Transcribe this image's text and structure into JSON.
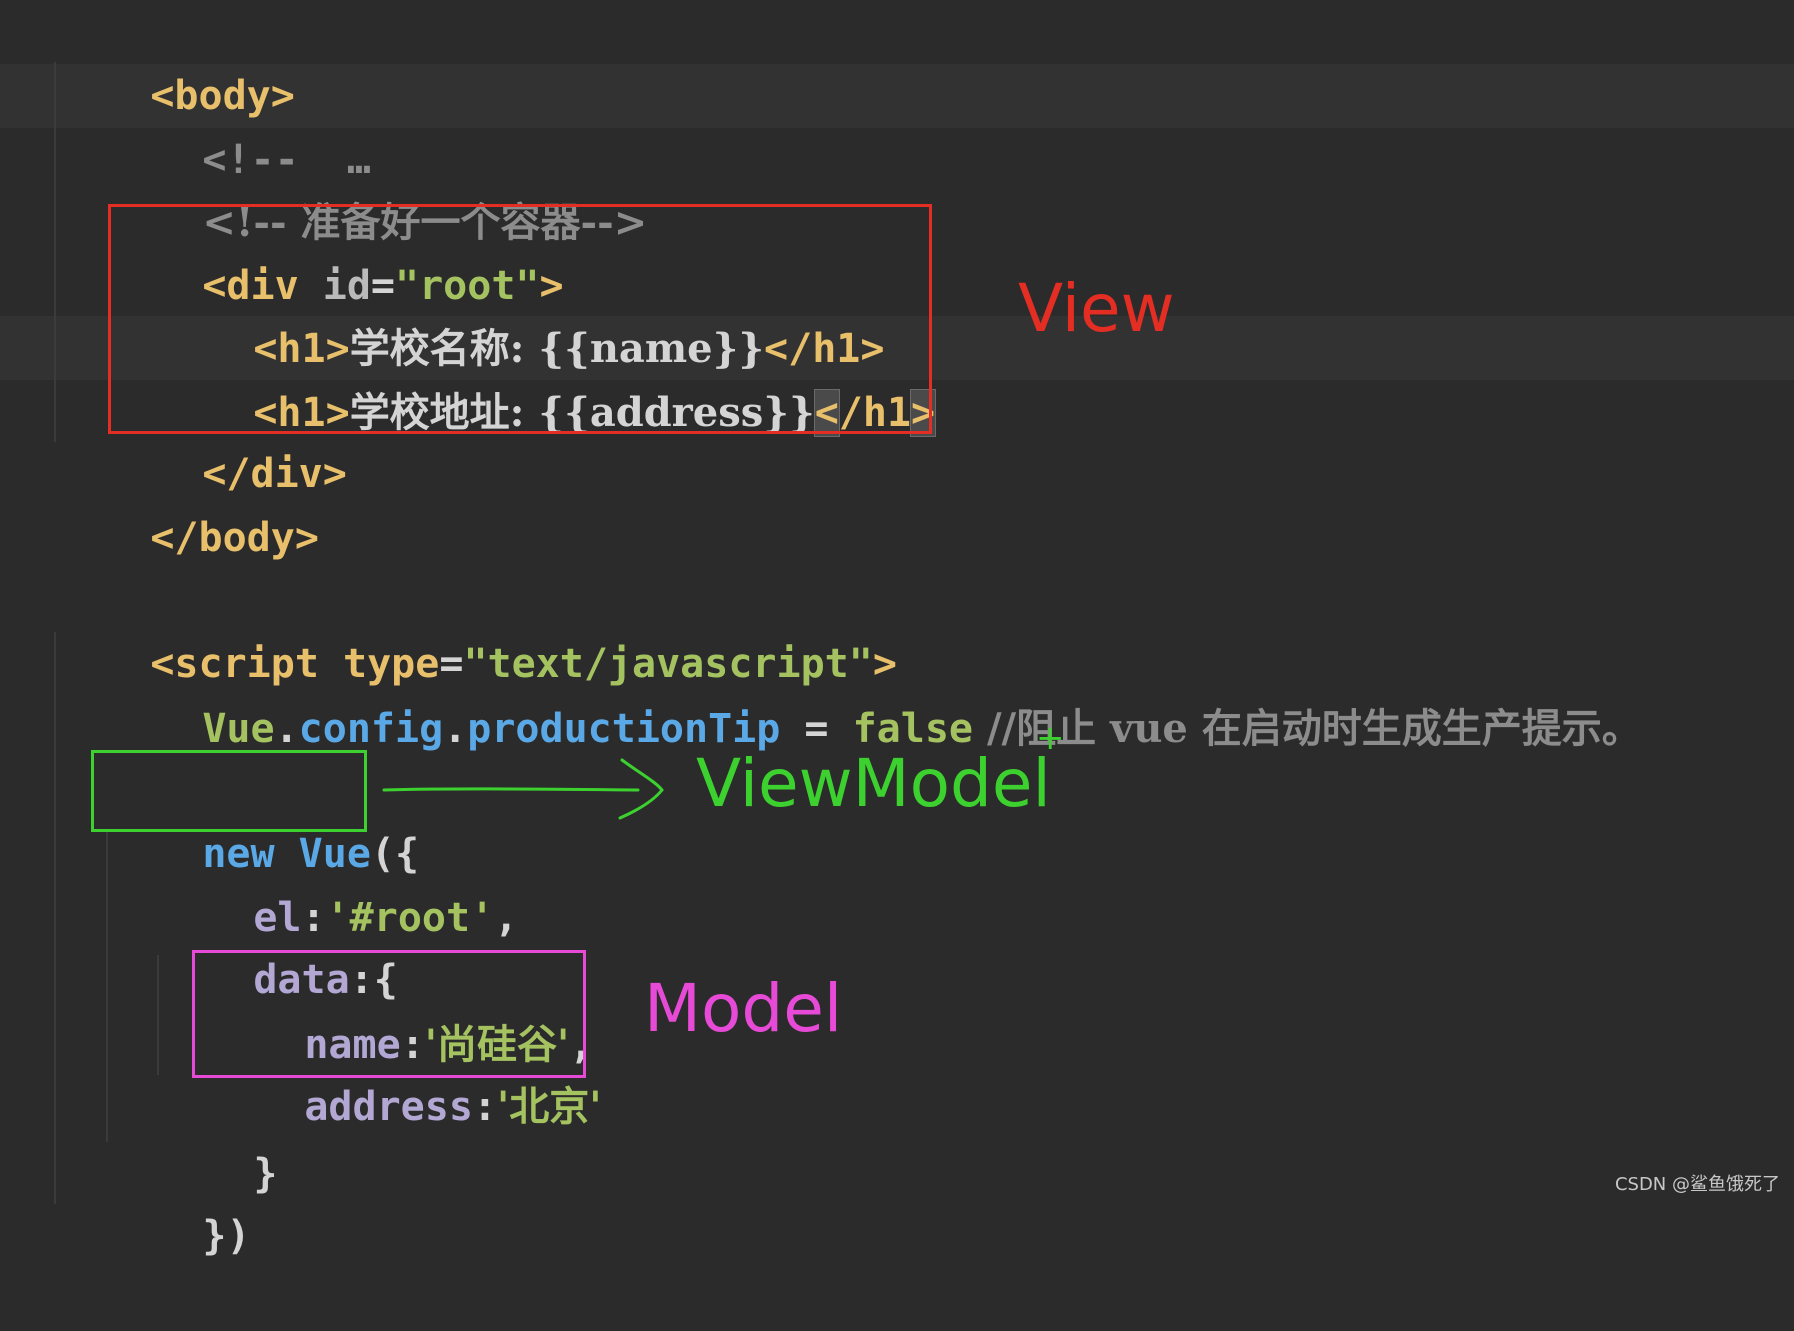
{
  "code": {
    "l1": {
      "open": "<",
      "tag": "body",
      "close": ">"
    },
    "l2": {
      "text": "<!--  …"
    },
    "l3": {
      "text": "<!-- 准备好一个容器-->"
    },
    "l4": {
      "open": "<",
      "tag": "div",
      "attr": " id",
      "eq": "=",
      "value": "\"root\"",
      "close": ">"
    },
    "l5": {
      "open": "<",
      "tag": "h1",
      "close": ">",
      "text": "学校名称: {{name}}",
      "end_open": "</",
      "end_tag": "h1",
      "end_close": ">"
    },
    "l6": {
      "open": "<",
      "tag": "h1",
      "close": ">",
      "text": "学校地址: {{address}}",
      "end_open": "<",
      "end_slash_tag": "/h1",
      "end_close": ">"
    },
    "l7": {
      "open": "</",
      "tag": "div",
      "close": ">"
    },
    "l8": {
      "open": "</",
      "tag": "body",
      "close": ">"
    },
    "l9": {
      "open": "<",
      "tag": "script",
      "attr": " type",
      "eq": "=",
      "value": "\"text/javascript\"",
      "close": ">"
    },
    "l10": {
      "obj": "Vue",
      "dot1": ".",
      "prop1": "config",
      "dot2": ".",
      "prop2": "productionTip",
      "eq": " = ",
      "kw": "false",
      "comment": " //阻止 vue 在启动时生成生产提示。"
    },
    "l11": {
      "kw": "new",
      "space": " ",
      "cls": "Vue",
      "rest": "({"
    },
    "l12": {
      "key": "el",
      "colon": ":",
      "value": "'#root'",
      "comma": ","
    },
    "l13": {
      "key": "data",
      "rest": ":{"
    },
    "l14": {
      "key": "name",
      "colon": ":",
      "value": "'尚硅谷'",
      "comma": ","
    },
    "l15": {
      "key": "address",
      "colon": ":",
      "value": "'北京'"
    },
    "l16": {
      "text": "}"
    },
    "l17": {
      "text": "})"
    }
  },
  "annotations": {
    "view": "View",
    "viewmodel": "ViewModel",
    "viewmodel_mark": "+",
    "model": "Model"
  },
  "colors": {
    "view": "#e52e23",
    "viewmodel": "#3cd12f",
    "model": "#e74ad6",
    "background": "#2b2b2b"
  },
  "watermark": "CSDN @鲨鱼饿死了"
}
